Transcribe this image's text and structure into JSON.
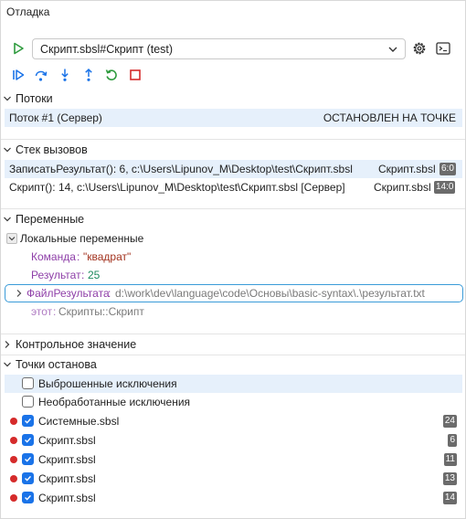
{
  "panel_title": "Отладка",
  "run_target": {
    "value": "Скрипт.sbsl#Скрипт (test)"
  },
  "sections": {
    "threads": "Потоки",
    "call_stack": "Стек вызовов",
    "variables": "Переменные",
    "watch": "Контрольное значение",
    "breakpoints": "Точки останова"
  },
  "threads": [
    {
      "name": "Поток #1 (Сервер)",
      "status": "ОСТАНОВЛЕН НА ТОЧКЕ"
    }
  ],
  "call_stack": [
    {
      "frame": "ЗаписатьРезультат(): 6, c:\\Users\\Lipunov_M\\Desktop\\test\\Скрипт.sbsl",
      "file": "Скрипт.sbsl",
      "pos": "6:0"
    },
    {
      "frame": "Скрипт(): 14, c:\\Users\\Lipunov_M\\Desktop\\test\\Скрипт.sbsl [Сервер]",
      "file": "Скрипт.sbsl",
      "pos": "14:0"
    }
  ],
  "variables": {
    "local_group": "Локальные переменные",
    "items": [
      {
        "name": "Команда",
        "sep": ": ",
        "value": "\"квадрат\""
      },
      {
        "name": "Результат",
        "sep": ": ",
        "value": "25"
      },
      {
        "name": "ФайлРезультата",
        "sep": ": ",
        "value": "d:\\work\\dev\\language\\code\\Основы\\basic-syntax\\.\\результат.txt"
      },
      {
        "name": "этот",
        "sep": ": ",
        "value": "Скрипты::Скрипт"
      }
    ]
  },
  "breakpoints": {
    "exceptions": [
      {
        "label": "Выброшенные исключения",
        "checked": false
      },
      {
        "label": "Необработанные исключения",
        "checked": false
      }
    ],
    "items": [
      {
        "file": "Системные.sbsl",
        "line": "24"
      },
      {
        "file": "Скрипт.sbsl",
        "line": "6"
      },
      {
        "file": "Скрипт.sbsl",
        "line": "11"
      },
      {
        "file": "Скрипт.sbsl",
        "line": "13"
      },
      {
        "file": "Скрипт.sbsl",
        "line": "14"
      }
    ]
  },
  "colors": {
    "accent": "#1a73e8",
    "run_green": "#2e9b3e",
    "breakpoint_red": "#d52b2b",
    "var_name": "#8e3fa8",
    "var_number": "#1d8a5e",
    "var_string": "#a3331f"
  }
}
